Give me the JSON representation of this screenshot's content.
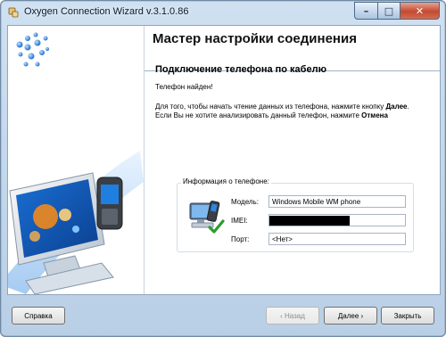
{
  "window": {
    "title": "Oxygen Connection Wizard v.3.1.0.86"
  },
  "header": {
    "title": "Мастер настройки соединения"
  },
  "page": {
    "subtitle": "Подключение телефона по кабелю",
    "found_text": "Телефон найден!",
    "instruction_1": "Для того, чтобы начать чтение данных из телефона, нажмите кнопку",
    "instruction_next": "Далее",
    "instruction_2": ". Если Вы не хотите анализировать данный телефон, нажмите",
    "instruction_cancel": "Отмена"
  },
  "phone_info": {
    "group_title": "Информация о телефоне:",
    "model_label": "Модель:",
    "model_value": "Windows Mobile WM phone",
    "imei_label": "IMEI:",
    "imei_value": "",
    "port_label": "Порт:",
    "port_value": "<Нет>"
  },
  "buttons": {
    "help": "Справка",
    "back": "‹ Назад",
    "next": "Далее ›",
    "close": "Закрыть"
  },
  "colors": {
    "accent_blue": "#1f6fd1",
    "close_red": "#c44a30",
    "header_border": "#9fb3c7"
  },
  "icons": {
    "app": "connector-plug-icon",
    "minimize": "minimize-icon",
    "maximize": "maximize-icon",
    "close": "close-icon",
    "phone_pc": "phone-computer-check-icon"
  }
}
